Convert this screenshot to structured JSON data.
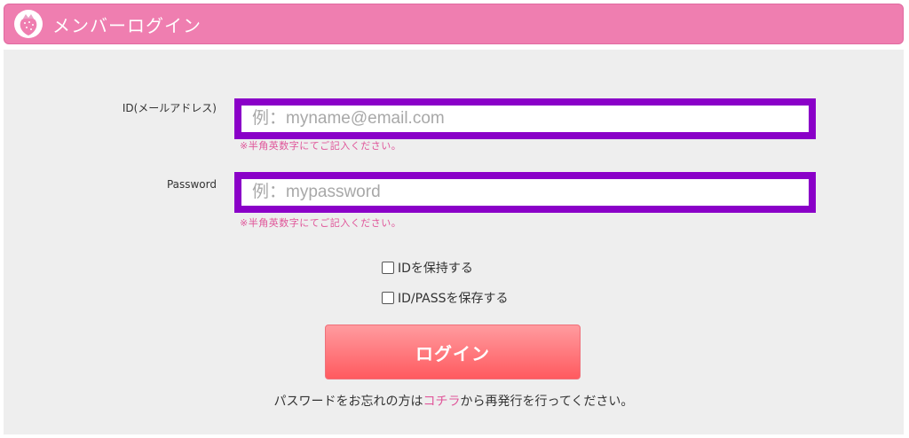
{
  "header": {
    "title": "メンバーログイン",
    "logo_icon": "strawberry-icon"
  },
  "form": {
    "id_label": "ID(メールアドレス)",
    "id_placeholder": "例：myname@email.com",
    "id_hint": "※半角英数字にてご記入ください。",
    "password_label": "Password",
    "password_placeholder": "例：mypassword",
    "password_hint": "※半角英数字にてご記入ください。",
    "remember_id_label": "IDを保持する",
    "remember_idpass_label": "ID/PASSを保存する",
    "login_button": "ログイン"
  },
  "footer": {
    "text_before": "パスワードをお忘れの方は",
    "link_text": "コチラ",
    "text_after": "から再発行を行ってください。"
  },
  "colors": {
    "header_bg": "#ef7eb0",
    "field_border": "#8a00c8",
    "hint": "#e0569a",
    "button": "#ff5a5f"
  }
}
